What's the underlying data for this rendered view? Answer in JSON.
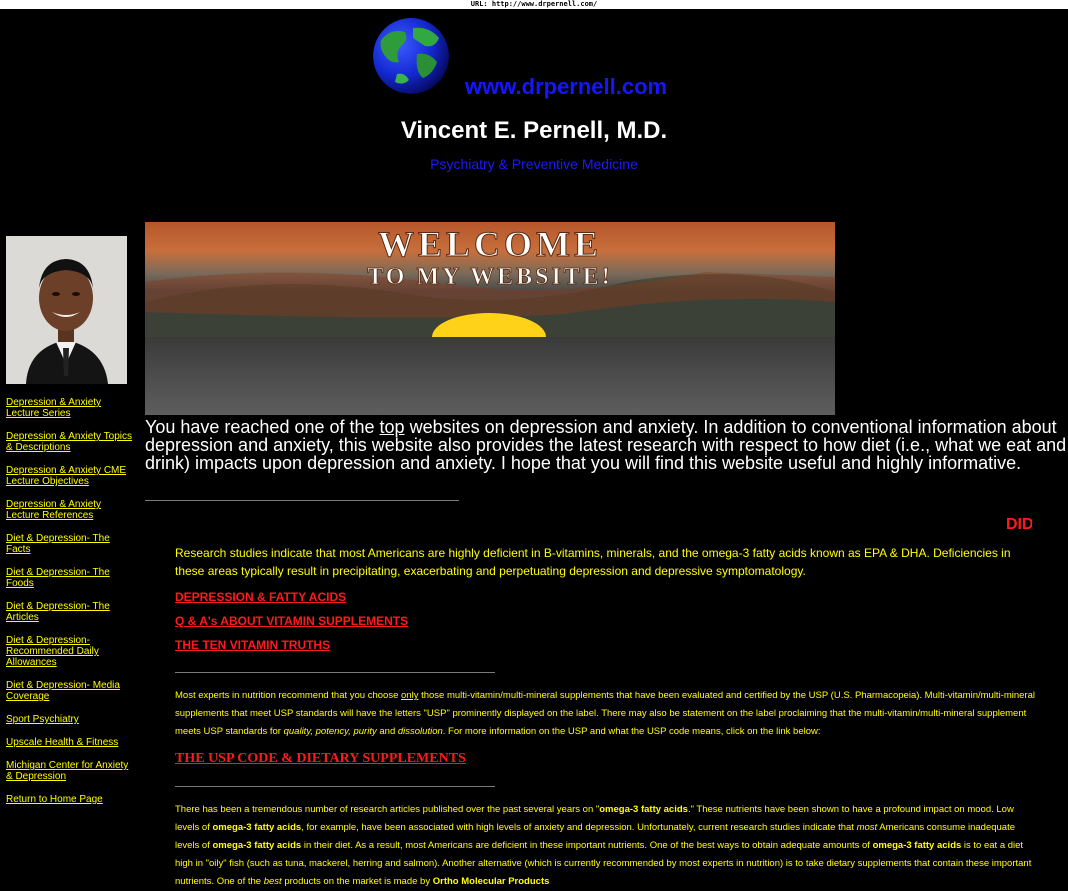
{
  "url_bar": "URL: http://www.drpernell.com/",
  "header": {
    "site_url": "www.drpernell.com",
    "name": "Vincent E. Pernell, M.D.",
    "specialty": "Psychiatry & Preventive Medicine"
  },
  "banner": {
    "line1": "WELCOME",
    "line2": "TO MY WEBSITE!"
  },
  "sidebar": {
    "items": [
      {
        "label": "Depression & Anxiety Lecture Series"
      },
      {
        "label": "Depression & Anxiety Topics & Descriptions"
      },
      {
        "label": "Depression & Anxiety CME Lecture Objectives"
      },
      {
        "label": "Depression & Anxiety Lecture References"
      },
      {
        "label": "Diet & Depression- The Facts"
      },
      {
        "label": "Diet & Depression- The Foods"
      },
      {
        "label": "Diet & Depression- The Articles"
      },
      {
        "label": "Diet & Depression- Recommended Daily Allowances"
      },
      {
        "label": "Diet & Depression- Media Coverage"
      },
      {
        "label": "Sport Psychiatry"
      },
      {
        "label": "Upscale Health & Fitness"
      },
      {
        "label": "Michigan Center for Anxiety & Depression"
      },
      {
        "label": "Return to Home Page"
      }
    ]
  },
  "intro": {
    "before": "You have reached one of the ",
    "top_link": "top",
    "after": " websites on depression and anxiety.  In addition to conventional information about depression and anxiety, this website also provides the latest research with respect to how diet (i.e., what we eat and drink) impacts upon depression and anxiety.  I hope that you will find this website useful and highly informative."
  },
  "marquee": "DID",
  "research": "Research studies indicate that most Americans are highly deficient in B-vitamins, minerals, and the omega-3 fatty acids known as EPA & DHA. Deficiencies in these areas typically result in precipitating, exacerbating and perpetuating depression and depressive symptomatology.",
  "links": {
    "fatty_acids": "DEPRESSION & FATTY ACIDS",
    "qa": "Q & A's ABOUT VITAMIN SUPPLEMENTS",
    "truths": "THE TEN VITAMIN TRUTHS",
    "usp_code": "THE USP CODE &  DIETARY SUPPLEMENTS"
  },
  "usp_para": {
    "t1": "Most experts in nutrition recommend that you choose ",
    "only": "only",
    "t2": " those multi-vitamin/multi-mineral supplements that have been evaluated and certified by the USP (U.S. Pharmacopeia).  Multi-vitamin/multi-mineral supplements that meet USP standards will have the letters  \"USP\"  prominently displayed on the label. There may also be statement on the label proclaiming that the multi-vitamin/multi-mineral supplement meets USP standards for ",
    "quality": "quality, potency, purity",
    "and": " and ",
    "dissolution": "dissolution",
    "t3": ".   For more information on the USP and what the USP code means, click on the link below:"
  },
  "omega_para": {
    "a": "There has been a tremendous number of research articles published over the past several years on \"",
    "b": "omega-3 fatty acids",
    "c": ".\"   These nutrients have been shown to have a profound impact on mood.  Low levels of ",
    "d": "omega-3 fatty acids",
    "e": ", for example, have been associated with high levels of anxiety and depression.  Unfortunately, current research studies indicate that ",
    "f": "most",
    "g": " Americans consume inadequate levels of ",
    "h": "omega-3 fatty acids",
    "i": " in their diet.  As a result, most Americans are deficient in these important nutrients.  One of the best ways to obtain adequate amounts of ",
    "j": "omega-3 fatty acids",
    "k": " is to eat a diet high in \"oily\" fish (such as tuna, mackerel, herring and salmon).  Another alternative (which is currently recommended by most experts in nutrition) is to take dietary supplements that contain these important nutrients.  One of the ",
    "l": "best",
    "m": " products on the market is made by ",
    "n": "Ortho Molecular Products"
  },
  "colors": {
    "background": "#000000",
    "link": "#ffff00",
    "accent_red": "#ff1a1a",
    "url_blue": "#1515ff"
  }
}
